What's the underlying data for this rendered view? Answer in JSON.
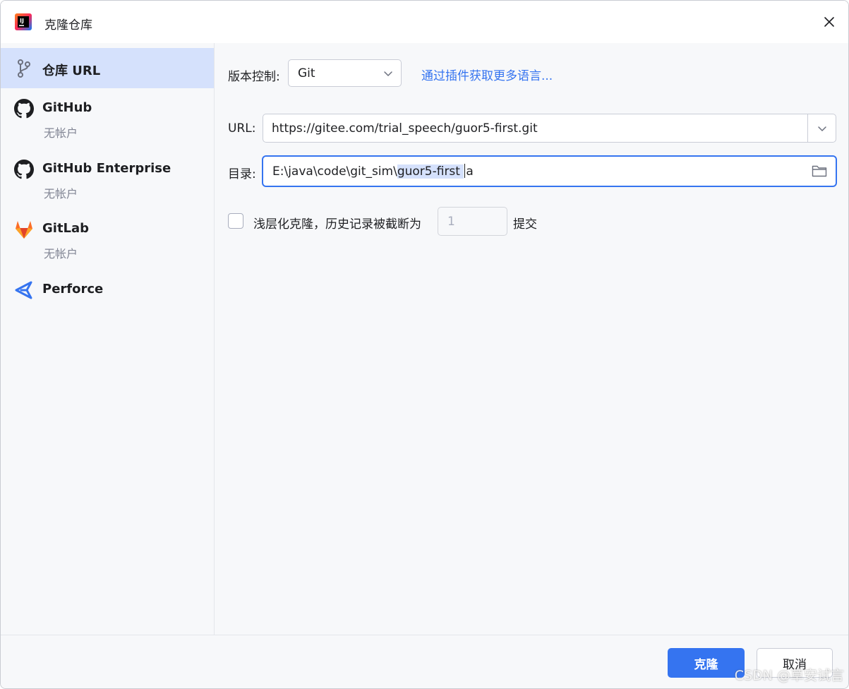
{
  "window": {
    "title": "克隆仓库",
    "accent_color": "#3574f0"
  },
  "sidebar": {
    "items": [
      {
        "label": "仓库 URL",
        "sub": "",
        "icon": "branch-icon",
        "selected": true
      },
      {
        "label": "GitHub",
        "sub": "无帐户",
        "icon": "github-icon",
        "selected": false
      },
      {
        "label": "GitHub Enterprise",
        "sub": "无帐户",
        "icon": "github-icon",
        "selected": false
      },
      {
        "label": "GitLab",
        "sub": "无帐户",
        "icon": "gitlab-icon",
        "selected": false
      },
      {
        "label": "Perforce",
        "sub": "",
        "icon": "perforce-icon",
        "selected": false
      }
    ]
  },
  "main": {
    "vcs_label": "版本控制:",
    "vcs_value": "Git",
    "plugins_link": "通过插件获取更多语言...",
    "url_label": "URL:",
    "url_value": "https://gitee.com/trial_speech/guor5-first.git",
    "dir_label": "目录:",
    "dir_prefix": "E:\\java\\code\\git_sim\\",
    "dir_selected": "guor5-first ",
    "dir_suffix": "a",
    "shallow_label": "浅层化克隆，历史记录被截断为",
    "shallow_depth": "1",
    "shallow_unit": "提交",
    "shallow_checked": false
  },
  "footer": {
    "clone_button": "克隆",
    "cancel_button": "取消"
  },
  "watermark": "CSDN @草安试言"
}
